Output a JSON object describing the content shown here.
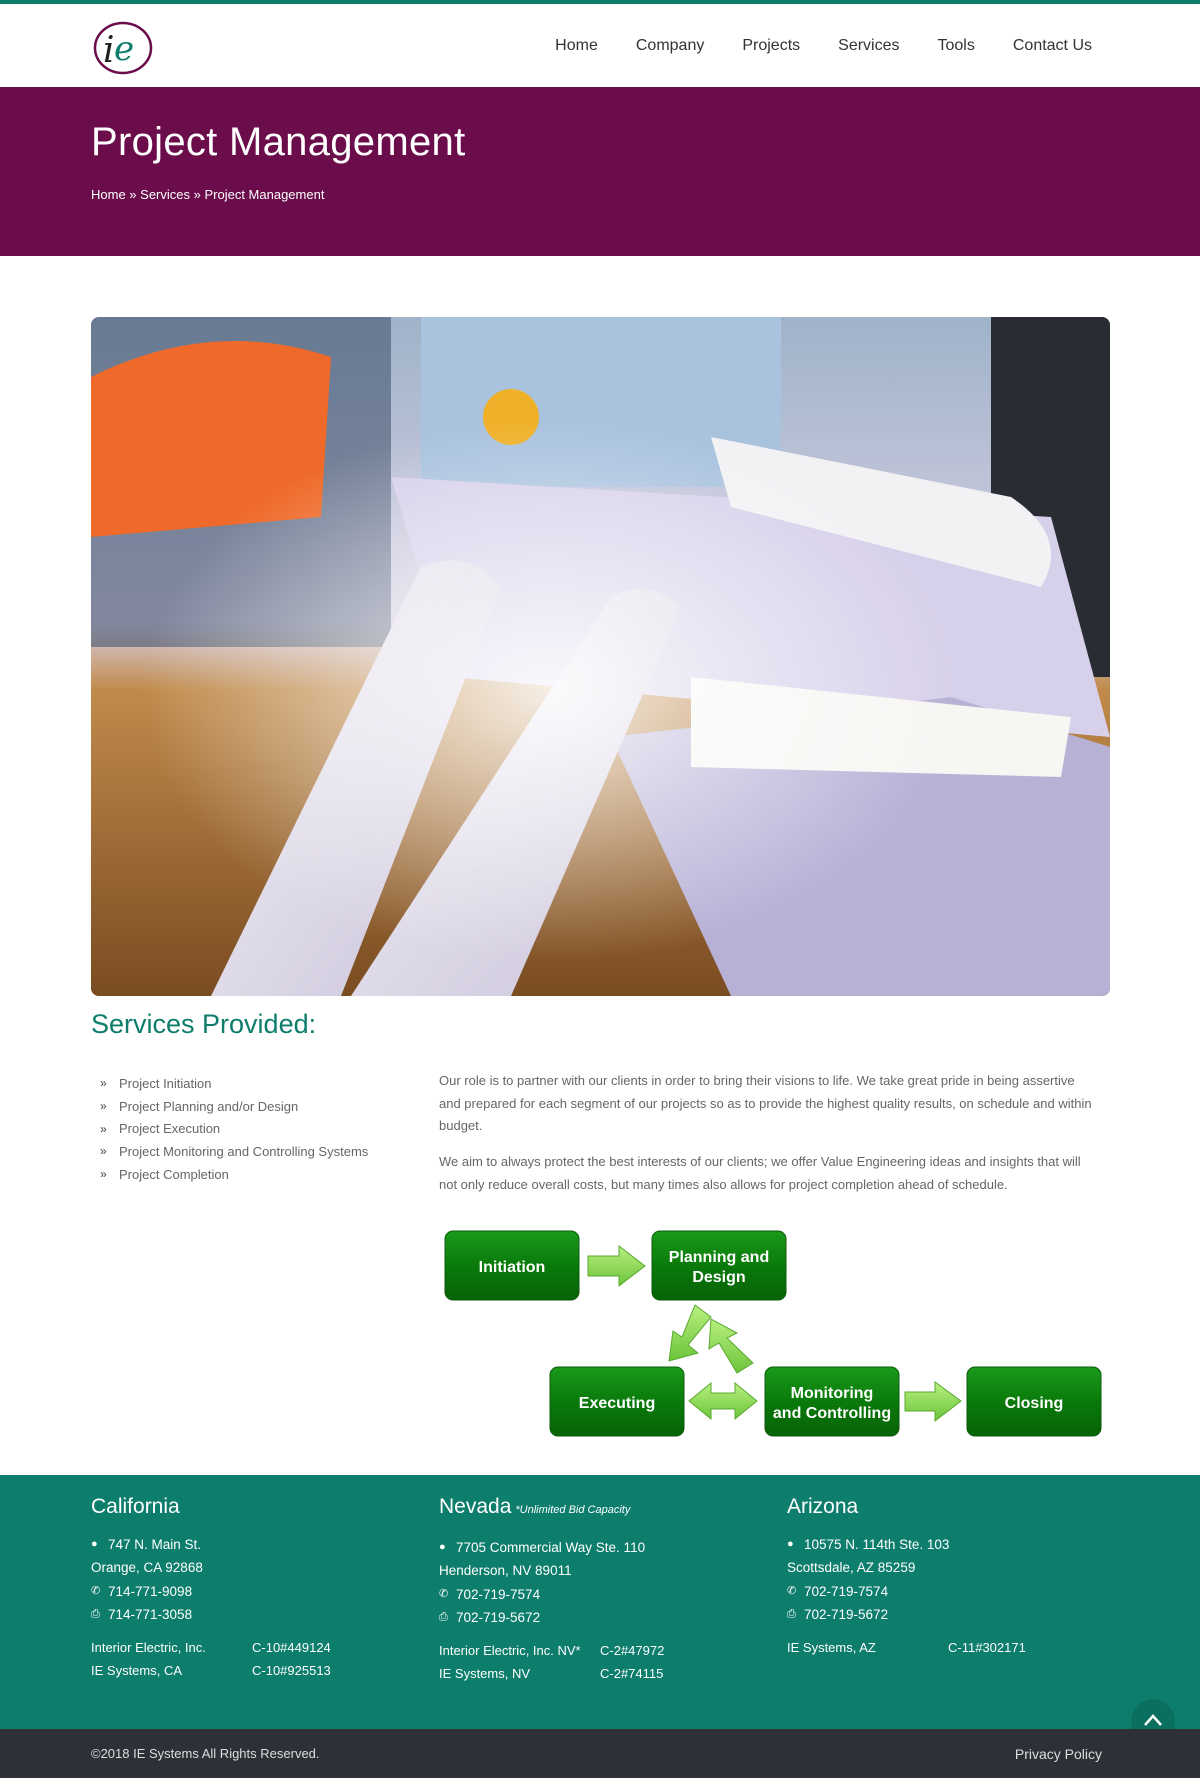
{
  "nav": {
    "items": [
      "Home",
      "Company",
      "Projects",
      "Services",
      "Tools",
      "Contact Us"
    ]
  },
  "banner": {
    "title": "Project Management",
    "breadcrumb": {
      "home": "Home",
      "sep1": " » ",
      "services": "Services",
      "sep2": " » ",
      "current": "Project Management"
    }
  },
  "services": {
    "title": "Services Provided:",
    "items": [
      "Project Initiation",
      "Project Planning and/or Design",
      "Project Execution",
      "Project Monitoring and Controlling Systems",
      "Project Completion"
    ],
    "paragraph1": "Our role is to partner with our clients in order to bring their visions to life. We take great pride in being assertive and prepared for each segment of our projects so as to provide the highest quality results, on schedule and within budget.",
    "paragraph2": "We aim to always protect the best interests of our clients; we offer Value Engineering ideas and insights that will not only reduce overall costs, but many times also allows for project completion ahead of schedule."
  },
  "diagram": {
    "initiation": "Initiation",
    "planning_1": "Planning and",
    "planning_2": "Design",
    "executing": "Executing",
    "monitoring_1": "Monitoring",
    "monitoring_2": "and Controlling",
    "closing": "Closing",
    "box_color": "#0a7a0a",
    "arrow_color": "#8de05a"
  },
  "footer": {
    "california": {
      "title": "California",
      "address1": "747 N. Main St.",
      "address2": "Orange, CA 92868",
      "phone": "714-771-9098",
      "fax": "714-771-3058",
      "licenses": [
        {
          "name": "Interior Electric, Inc.",
          "number": "C-10#449124"
        },
        {
          "name": "IE Systems, CA",
          "number": "C-10#925513"
        }
      ]
    },
    "nevada": {
      "title": "Nevada",
      "note": "*Unlimited Bid Capacity",
      "address1": "7705 Commercial Way Ste. 110",
      "address2": "Henderson, NV 89011",
      "phone": "702-719-7574",
      "fax": "702-719-5672",
      "licenses": [
        {
          "name": "Interior Electric, Inc. NV*",
          "number": "C-2#47972"
        },
        {
          "name": "IE Systems, NV",
          "number": "C-2#74115"
        }
      ]
    },
    "arizona": {
      "title": "Arizona",
      "address1": "10575 N. 114th Ste. 103",
      "address2": "Scottsdale, AZ 85259",
      "phone": "702-719-7574",
      "fax": "702-719-5672",
      "licenses": [
        {
          "name": "IE Systems, AZ",
          "number": "C-11#302171"
        }
      ]
    }
  },
  "bottom": {
    "copyright": "©2018 IE Systems All Rights Reserved.",
    "privacy": "Privacy Policy"
  },
  "icons": {
    "pin": "map-pin-icon",
    "phone": "phone-icon",
    "fax": "fax-icon",
    "to_top": "chevron-up-icon"
  },
  "colors": {
    "brand_purple": "#6b0d4b",
    "brand_teal": "#0d7d6c",
    "footer_bottom": "#2e3038"
  }
}
